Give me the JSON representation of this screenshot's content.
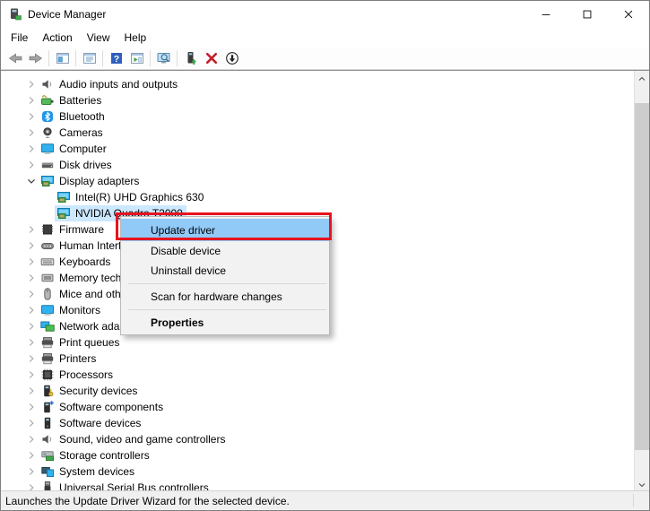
{
  "window": {
    "title": "Device Manager"
  },
  "titlebar": {
    "controls": [
      {
        "name": "minimize"
      },
      {
        "name": "maximize"
      },
      {
        "name": "close"
      }
    ]
  },
  "menubar": {
    "items": [
      "File",
      "Action",
      "View",
      "Help"
    ]
  },
  "toolbar": {
    "buttons": [
      {
        "name": "back",
        "icon": "arrow-left"
      },
      {
        "name": "forward",
        "icon": "arrow-right"
      },
      {
        "separator": true
      },
      {
        "name": "show-console-tree",
        "icon": "console-window"
      },
      {
        "separator": true
      },
      {
        "name": "properties",
        "icon": "properties-window"
      },
      {
        "separator": true
      },
      {
        "name": "help",
        "icon": "help"
      },
      {
        "name": "action-pane",
        "icon": "window-play"
      },
      {
        "separator": true
      },
      {
        "name": "devices-view",
        "icon": "monitor-search"
      },
      {
        "separator": true
      },
      {
        "name": "update-driver",
        "icon": "update-driver"
      },
      {
        "name": "uninstall-device",
        "icon": "uninstall"
      },
      {
        "name": "scan-hardware-changes",
        "icon": "scan"
      }
    ]
  },
  "tree": {
    "items": [
      {
        "label": "Audio inputs and outputs",
        "icon": "speaker",
        "level": 0,
        "expand": "collapsed",
        "selected": false
      },
      {
        "label": "Batteries",
        "icon": "battery",
        "level": 0,
        "expand": "collapsed",
        "selected": false
      },
      {
        "label": "Bluetooth",
        "icon": "bluetooth",
        "level": 0,
        "expand": "collapsed",
        "selected": false
      },
      {
        "label": "Cameras",
        "icon": "camera",
        "level": 0,
        "expand": "collapsed",
        "selected": false
      },
      {
        "label": "Computer",
        "icon": "computer",
        "level": 0,
        "expand": "collapsed",
        "selected": false
      },
      {
        "label": "Disk drives",
        "icon": "disk",
        "level": 0,
        "expand": "collapsed",
        "selected": false
      },
      {
        "label": "Display adapters",
        "icon": "display-adapter",
        "level": 0,
        "expand": "expanded",
        "selected": false
      },
      {
        "label": "Intel(R) UHD Graphics 630",
        "icon": "display-adapter",
        "level": 1,
        "expand": "none",
        "selected": false
      },
      {
        "label": "NVIDIA Quadro T2000",
        "icon": "display-adapter",
        "level": 1,
        "expand": "none",
        "selected": true
      },
      {
        "label": "Firmware",
        "icon": "firmware",
        "level": 0,
        "expand": "collapsed",
        "selected": false
      },
      {
        "label": "Human Interface Devices",
        "icon": "hid",
        "level": 0,
        "expand": "collapsed",
        "selected": false
      },
      {
        "label": "Keyboards",
        "icon": "keyboard",
        "level": 0,
        "expand": "collapsed",
        "selected": false
      },
      {
        "label": "Memory technology devices",
        "icon": "memory",
        "level": 0,
        "expand": "collapsed",
        "selected": false
      },
      {
        "label": "Mice and other pointing devices",
        "icon": "mouse",
        "level": 0,
        "expand": "collapsed",
        "selected": false
      },
      {
        "label": "Monitors",
        "icon": "monitor",
        "level": 0,
        "expand": "collapsed",
        "selected": false
      },
      {
        "label": "Network adapters",
        "icon": "network",
        "level": 0,
        "expand": "collapsed",
        "selected": false
      },
      {
        "label": "Print queues",
        "icon": "printer",
        "level": 0,
        "expand": "collapsed",
        "selected": false
      },
      {
        "label": "Printers",
        "icon": "printer",
        "level": 0,
        "expand": "collapsed",
        "selected": false
      },
      {
        "label": "Processors",
        "icon": "processor",
        "level": 0,
        "expand": "collapsed",
        "selected": false
      },
      {
        "label": "Security devices",
        "icon": "security-device",
        "level": 0,
        "expand": "collapsed",
        "selected": false
      },
      {
        "label": "Software components",
        "icon": "software-component",
        "level": 0,
        "expand": "collapsed",
        "selected": false
      },
      {
        "label": "Software devices",
        "icon": "software-device",
        "level": 0,
        "expand": "collapsed",
        "selected": false
      },
      {
        "label": "Sound, video and game controllers",
        "icon": "speaker",
        "level": 0,
        "expand": "collapsed",
        "selected": false
      },
      {
        "label": "Storage controllers",
        "icon": "storage",
        "level": 0,
        "expand": "collapsed",
        "selected": false
      },
      {
        "label": "System devices",
        "icon": "system-device",
        "level": 0,
        "expand": "collapsed",
        "selected": false
      },
      {
        "label": "Universal Serial Bus controllers",
        "icon": "usb",
        "level": 0,
        "expand": "collapsed",
        "selected": false
      }
    ]
  },
  "context_menu": {
    "items": [
      {
        "label": "Update driver",
        "highlighted": true
      },
      {
        "label": "Disable device"
      },
      {
        "label": "Uninstall device"
      },
      {
        "label": "Scan for hardware changes"
      },
      {
        "label": "Properties",
        "bold": true
      }
    ]
  },
  "status_bar": {
    "text": "Launches the Update Driver Wizard for the selected device."
  },
  "colors": {
    "selection_bg": "#cce8ff",
    "menu_highlight": "#91c9f7",
    "annotation_red": "#e8131e",
    "accent_blue": "#2fb2ef"
  }
}
